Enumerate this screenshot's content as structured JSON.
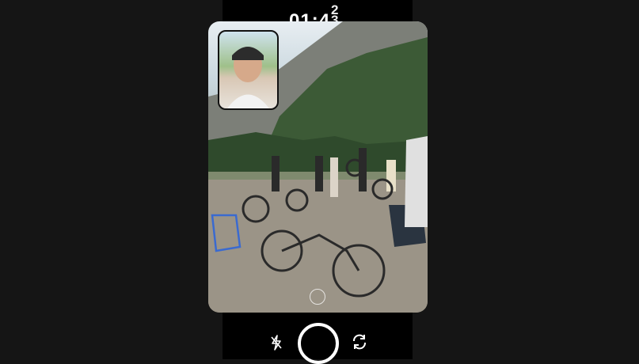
{
  "timer": {
    "main": "01:4",
    "rolling_digits": [
      "2",
      "3"
    ]
  },
  "icons": {
    "flash": "flash-off-icon",
    "flip": "camera-flip-icon",
    "focus": "focus-icon",
    "shutter": "shutter-button"
  },
  "colors": {
    "background": "#151515",
    "phone": "#000000",
    "accent": "#ffffff"
  }
}
